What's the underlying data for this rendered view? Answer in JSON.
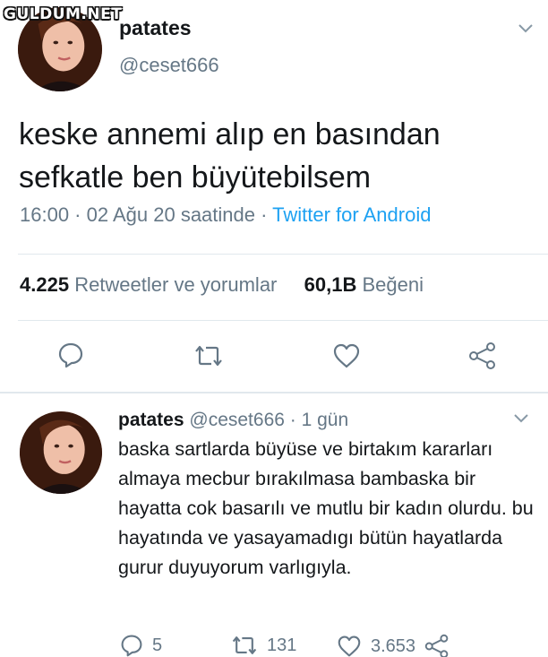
{
  "watermark": "GULDUM.NET",
  "tweet": {
    "name": "patates",
    "handle": "@ceset666",
    "text": "keske annemi alıp en basından sefkatle ben büyütebilsem",
    "time": "16:00 · 02 Ağu 20 saatinde · ",
    "source": "Twitter for Android",
    "retweet_count": "4.225",
    "retweet_label": "Retweetler ve yorumlar",
    "like_count": "60,1B",
    "like_label": "Beğeni"
  },
  "reply": {
    "name": "patates",
    "handle": "@ceset666",
    "time": "· 1 gün",
    "text": "baska sartlarda büyüse ve birtakım kararları almaya mecbur bırakılmasa bambaska bir hayatta cok basarılı ve mutlu bir kadın olurdu. bu hayatında ve yasayamadıgı bütün hayatlarda gurur duyuyorum varlıgıyla.",
    "reply_count": "5",
    "retweet_count": "131",
    "like_count": "3.653"
  },
  "icons": {
    "reply": "reply-icon",
    "retweet": "retweet-icon",
    "like": "heart-icon",
    "share": "share-icon",
    "more": "chevron-down-icon"
  },
  "colors": {
    "text": "#14171a",
    "secondary": "#657786",
    "link": "#1da1f2",
    "divider": "#e1e8ed"
  }
}
